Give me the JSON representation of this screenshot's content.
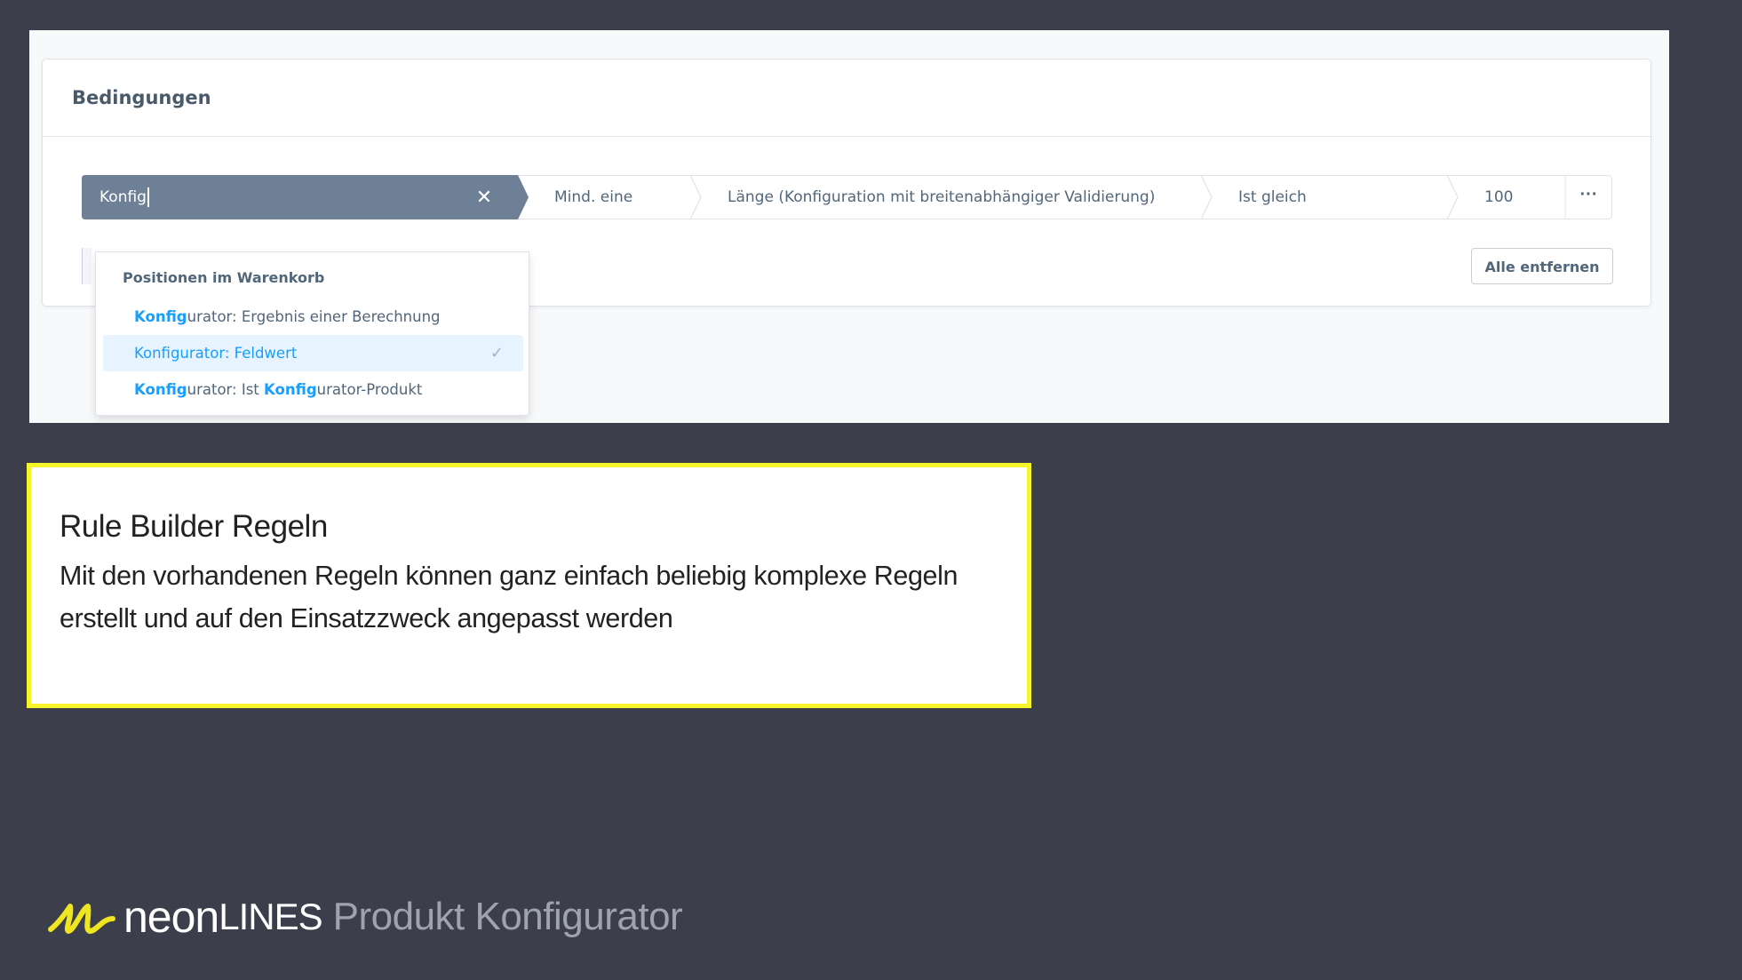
{
  "card": {
    "title": "Bedingungen"
  },
  "rule": {
    "search_value": "Konfig",
    "match_label": "Mind. eine",
    "field_label": "Länge (Konfiguration mit breitenabhängiger Validierung)",
    "operator_label": "Ist gleich",
    "value": "100",
    "more_label": "···"
  },
  "dropdown": {
    "group_label": "Positionen im Warenkorb",
    "items": [
      {
        "highlight": "Konfig",
        "rest": "urator: Ergebnis einer Berechnung"
      },
      {
        "label": "Konfigurator: Feldwert",
        "selected": true
      },
      {
        "highlight": "Konfig",
        "middle": "urator: Ist ",
        "highlight2": "Konfig",
        "rest": "urator-Produkt"
      }
    ]
  },
  "actions": {
    "remove_all_label": "Alle entfernen"
  },
  "info": {
    "title": "Rule Builder Regeln",
    "body": "Mit den vorhandenen Regeln können ganz einfach beliebig komplexe Regeln erstellt und auf den Einsatzzweck angepasst werden"
  },
  "footer": {
    "brand_neon": "neon",
    "brand_lines": "LINES",
    "product": "Produkt Konfigurator"
  },
  "colors": {
    "background": "#3c3f4b",
    "accent": "#189eff",
    "highlight_border": "#f5f52a",
    "selected_segment": "#6d8096",
    "logo_yellow": "#f0e521"
  },
  "icons": [
    "close-icon",
    "checkmark-icon",
    "more-icon",
    "neonlines-logo-icon"
  ]
}
